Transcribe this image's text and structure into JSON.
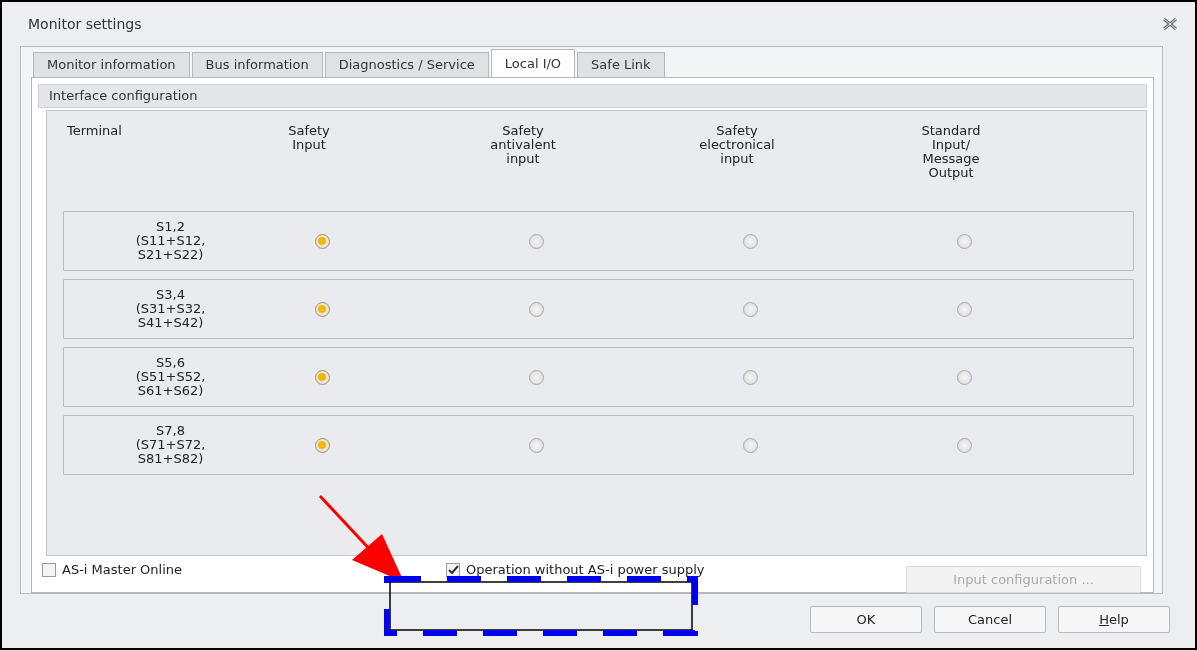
{
  "window": {
    "title": "Monitor settings"
  },
  "tabs": [
    {
      "label": "Monitor information",
      "selected": false
    },
    {
      "label": "Bus information",
      "selected": false
    },
    {
      "label": "Diagnostics / Service",
      "selected": false
    },
    {
      "label": "Local I/O",
      "selected": true
    },
    {
      "label": "Safe Link",
      "selected": false
    }
  ],
  "group": {
    "title": "Interface configuration"
  },
  "columns": [
    "Terminal",
    "Safety\nInput",
    "Safety\nantivalent\ninput",
    "Safety\nelectronical\ninput",
    "Standard\nInput/\nMessage\nOutput"
  ],
  "rows": [
    {
      "terminal": "S1,2\n(S11+S12,\nS21+S22)",
      "options": [
        {
          "selected": true
        },
        {
          "selected": false
        },
        {
          "selected": false
        },
        {
          "selected": false
        }
      ]
    },
    {
      "terminal": "S3,4\n(S31+S32,\nS41+S42)",
      "options": [
        {
          "selected": true
        },
        {
          "selected": false
        },
        {
          "selected": false
        },
        {
          "selected": false
        }
      ]
    },
    {
      "terminal": "S5,6\n(S51+S52,\nS61+S62)",
      "options": [
        {
          "selected": true
        },
        {
          "selected": false
        },
        {
          "selected": false
        },
        {
          "selected": false
        }
      ]
    },
    {
      "terminal": "S7,8\n(S71+S72,\nS81+S82)",
      "options": [
        {
          "selected": true
        },
        {
          "selected": false
        },
        {
          "selected": false
        },
        {
          "selected": false
        }
      ]
    }
  ],
  "checkboxes": [
    {
      "label": "AS-i Master Online",
      "checked": false
    },
    {
      "label": "Operation without AS-i power supply",
      "checked": true
    }
  ],
  "input_configuration": {
    "label": "Input configuration ...",
    "disabled": true
  },
  "buttons": [
    {
      "label": "OK",
      "kind": "plain"
    },
    {
      "label": "Cancel",
      "kind": "plain"
    },
    {
      "label": "Help",
      "kind": "mnemonic"
    }
  ]
}
